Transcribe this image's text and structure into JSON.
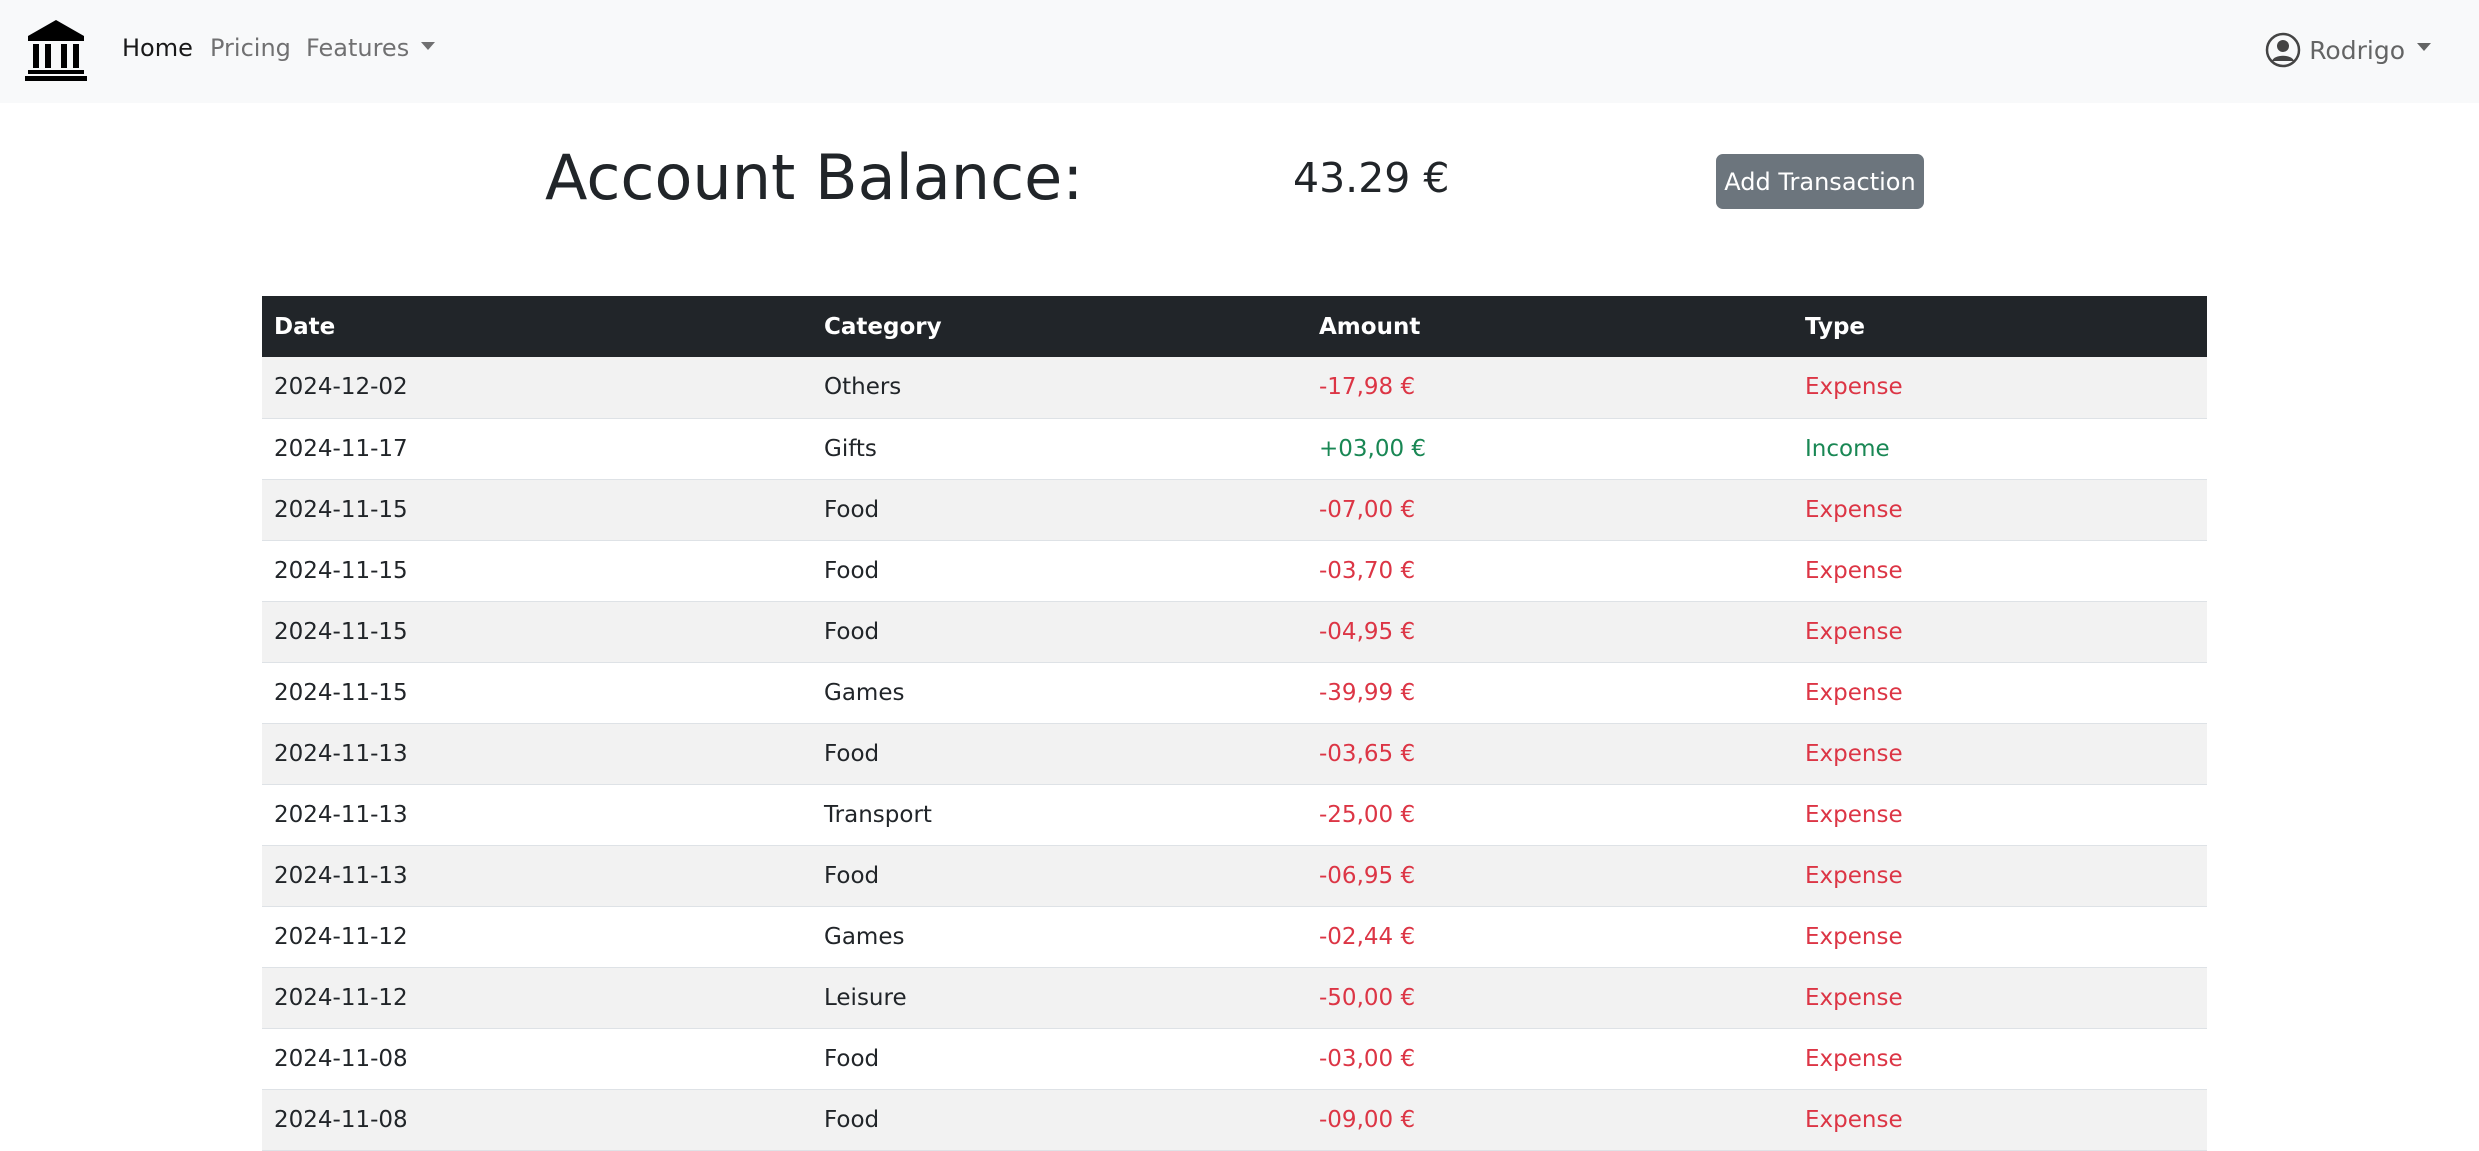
{
  "nav": {
    "home": "Home",
    "pricing": "Pricing",
    "features": "Features",
    "user": "Rodrigo",
    "logo_icon": "bank-icon",
    "user_icon": "user-circle-icon"
  },
  "balance": {
    "title": "Account Balance:",
    "value": "43.29 €"
  },
  "actions": {
    "add_transaction": "Add Transaction"
  },
  "colors": {
    "expense": "#dc3545",
    "income": "#198754",
    "header_bg": "#212529",
    "button_bg": "#6c757d"
  },
  "table": {
    "headers": {
      "date": "Date",
      "category": "Category",
      "amount": "Amount",
      "type": "Type"
    },
    "rows": [
      {
        "date": "2024-12-02",
        "category": "Others",
        "amount": "-17,98 €",
        "type": "Expense"
      },
      {
        "date": "2024-11-17",
        "category": "Gifts",
        "amount": "+03,00 €",
        "type": "Income"
      },
      {
        "date": "2024-11-15",
        "category": "Food",
        "amount": "-07,00 €",
        "type": "Expense"
      },
      {
        "date": "2024-11-15",
        "category": "Food",
        "amount": "-03,70 €",
        "type": "Expense"
      },
      {
        "date": "2024-11-15",
        "category": "Food",
        "amount": "-04,95 €",
        "type": "Expense"
      },
      {
        "date": "2024-11-15",
        "category": "Games",
        "amount": "-39,99 €",
        "type": "Expense"
      },
      {
        "date": "2024-11-13",
        "category": "Food",
        "amount": "-03,65 €",
        "type": "Expense"
      },
      {
        "date": "2024-11-13",
        "category": "Transport",
        "amount": "-25,00 €",
        "type": "Expense"
      },
      {
        "date": "2024-11-13",
        "category": "Food",
        "amount": "-06,95 €",
        "type": "Expense"
      },
      {
        "date": "2024-11-12",
        "category": "Games",
        "amount": "-02,44 €",
        "type": "Expense"
      },
      {
        "date": "2024-11-12",
        "category": "Leisure",
        "amount": "-50,00 €",
        "type": "Expense"
      },
      {
        "date": "2024-11-08",
        "category": "Food",
        "amount": "-03,00 €",
        "type": "Expense"
      },
      {
        "date": "2024-11-08",
        "category": "Food",
        "amount": "-09,00 €",
        "type": "Expense"
      }
    ]
  }
}
